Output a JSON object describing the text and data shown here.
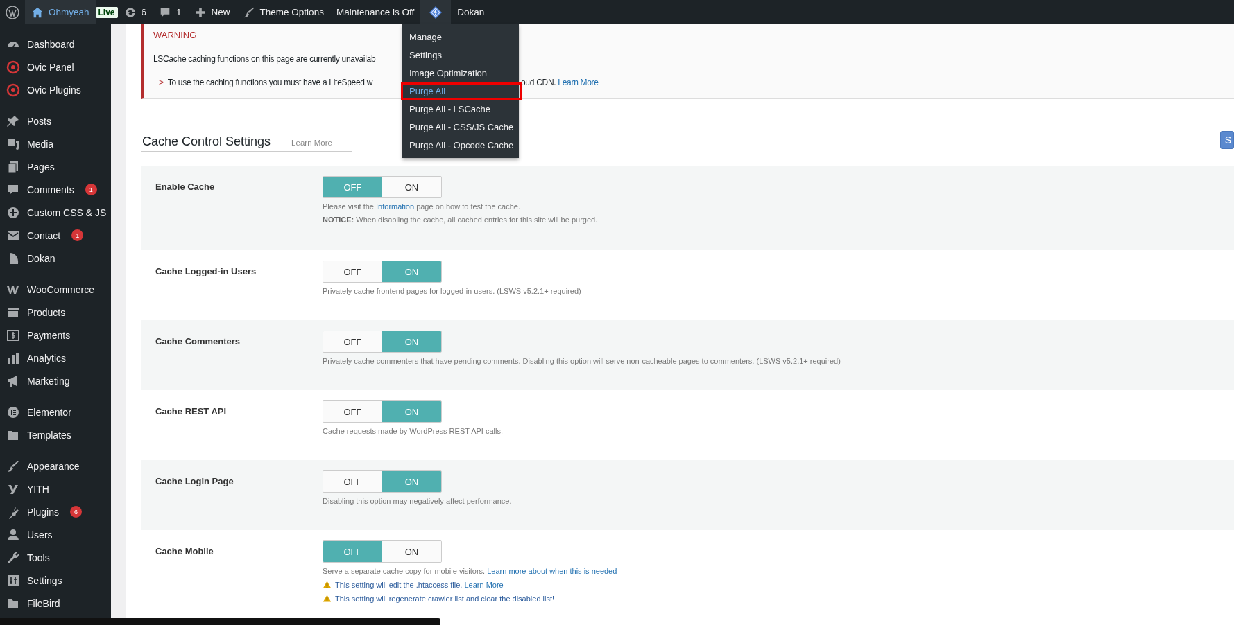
{
  "admin_bar": {
    "site": "Ohmyeah",
    "live_badge": "Live",
    "updates": "6",
    "comments": "1",
    "new": "New",
    "theme_options": "Theme Options",
    "maintenance": "Maintenance is Off",
    "dokan": "Dokan"
  },
  "dropdown": {
    "items": [
      {
        "label": "Manage",
        "selected": false
      },
      {
        "label": "Settings",
        "selected": false
      },
      {
        "label": "Image Optimization",
        "selected": false
      },
      {
        "label": "Purge All",
        "selected": true
      },
      {
        "label": "Purge All - LSCache",
        "selected": false
      },
      {
        "label": "Purge All - CSS/JS Cache",
        "selected": false
      },
      {
        "label": "Purge All - Opcode Cache",
        "selected": false
      }
    ]
  },
  "sidebar": {
    "groups": [
      [
        {
          "label": "Dashboard"
        },
        {
          "label": "Ovic Panel"
        },
        {
          "label": "Ovic Plugins"
        }
      ],
      [
        {
          "label": "Posts"
        },
        {
          "label": "Media"
        },
        {
          "label": "Pages"
        },
        {
          "label": "Comments",
          "badge": "1"
        },
        {
          "label": "Custom CSS & JS"
        },
        {
          "label": "Contact",
          "badge": "1"
        },
        {
          "label": "Dokan"
        }
      ],
      [
        {
          "label": "WooCommerce"
        },
        {
          "label": "Products"
        },
        {
          "label": "Payments"
        },
        {
          "label": "Analytics"
        },
        {
          "label": "Marketing"
        }
      ],
      [
        {
          "label": "Elementor"
        },
        {
          "label": "Templates"
        }
      ],
      [
        {
          "label": "Appearance"
        },
        {
          "label": "YITH"
        },
        {
          "label": "Plugins",
          "badge": "6"
        },
        {
          "label": "Users"
        },
        {
          "label": "Tools"
        },
        {
          "label": "Settings"
        },
        {
          "label": "FileBird"
        }
      ]
    ]
  },
  "warning": {
    "title": "WARNING",
    "message": "LSCache caching functions on this page are currently unavailab",
    "hint_marker": ">",
    "hint_start": "To use the caching functions you must have a LiteSpeed w",
    "hint_end": "oud CDN.",
    "hint_link": "Learn More"
  },
  "section": {
    "title": "Cache Control Settings",
    "learn_more": "Learn More",
    "button": "S"
  },
  "settings": [
    {
      "label": "Enable Cache",
      "off_label": "OFF",
      "on_label": "ON",
      "on": false,
      "notes": [
        {
          "kind": "text",
          "parts": [
            {
              "text": "Please visit the "
            },
            {
              "text": "Information",
              "link": true
            },
            {
              "text": " page on how to test the cache."
            }
          ]
        },
        {
          "kind": "text",
          "parts": [
            {
              "text": "**NOTICE:** When disabling the cache, all cached entries for this site will be purged."
            }
          ]
        }
      ]
    },
    {
      "label": "Cache Logged-in Users",
      "off_label": "OFF",
      "on_label": "ON",
      "on": true,
      "notes": [
        {
          "kind": "text",
          "parts": [
            {
              "text": "Privately cache frontend pages for logged-in users. (LSWS v5.2.1+ required)"
            }
          ]
        }
      ]
    },
    {
      "label": "Cache Commenters",
      "off_label": "OFF",
      "on_label": "ON",
      "on": true,
      "notes": [
        {
          "kind": "text",
          "parts": [
            {
              "text": "Privately cache commenters that have pending comments. Disabling this option will serve non-cacheable pages to commenters. (LSWS v5.2.1+ required)"
            }
          ]
        }
      ]
    },
    {
      "label": "Cache REST API",
      "off_label": "OFF",
      "on_label": "ON",
      "on": true,
      "notes": [
        {
          "kind": "text",
          "parts": [
            {
              "text": "Cache requests made by WordPress REST API calls."
            }
          ]
        }
      ]
    },
    {
      "label": "Cache Login Page",
      "off_label": "OFF",
      "on_label": "ON",
      "on": true,
      "notes": [
        {
          "kind": "text",
          "parts": [
            {
              "text": "Disabling this option may negatively affect performance."
            }
          ]
        }
      ]
    },
    {
      "label": "Cache Mobile",
      "off_label": "OFF",
      "on_label": "ON",
      "on": false,
      "notes": [
        {
          "kind": "text",
          "parts": [
            {
              "text": "Serve a separate cache copy for mobile visitors. "
            },
            {
              "text": "Learn more about when this is needed",
              "link": true
            }
          ]
        },
        {
          "kind": "warning",
          "parts": [
            {
              "text": "This setting will edit the .htaccess file. "
            },
            {
              "text": "Learn More",
              "link": true
            }
          ]
        },
        {
          "kind": "warning",
          "parts": [
            {
              "text": "This setting will regenerate crawler list and clear the disabled list!"
            }
          ]
        }
      ]
    }
  ]
}
